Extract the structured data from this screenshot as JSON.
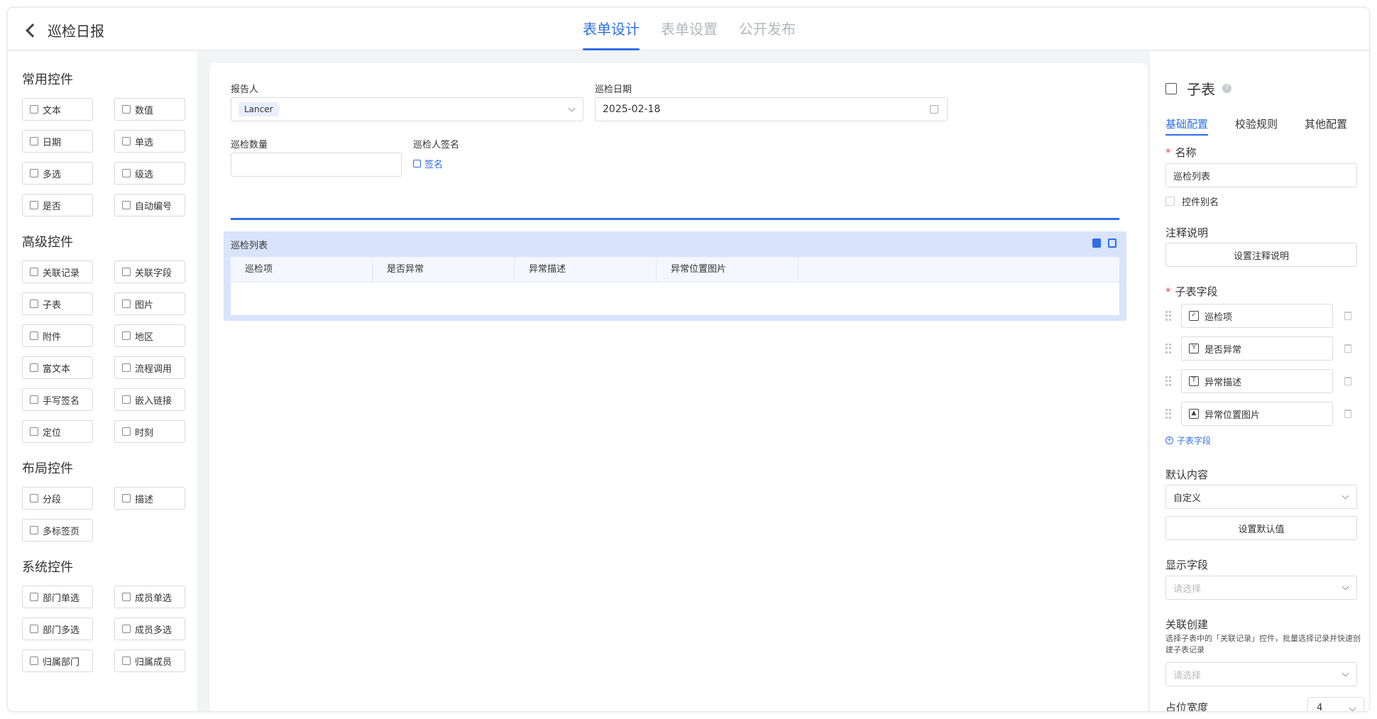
{
  "header": {
    "back_title": "巡检日报",
    "tabs": [
      {
        "label": "表单设计"
      },
      {
        "label": "表单设置"
      },
      {
        "label": "公开发布"
      }
    ]
  },
  "left_panel": {
    "groups": [
      {
        "title": "常用控件",
        "items": [
          "文本",
          "数值",
          "日期",
          "单选",
          "多选",
          "级选",
          "是否",
          "自动编号"
        ]
      },
      {
        "title": "高级控件",
        "items": [
          "关联记录",
          "关联字段",
          "子表",
          "图片",
          "附件",
          "地区",
          "富文本",
          "流程调用",
          "手写签名",
          "嵌入链接",
          "定位",
          "时刻"
        ]
      },
      {
        "title": "布局控件",
        "items": [
          "分段",
          "描述",
          "多标签页"
        ]
      },
      {
        "title": "系统控件",
        "items": [
          "部门单选",
          "成员单选",
          "部门多选",
          "成员多选",
          "归属部门",
          "归属成员"
        ]
      }
    ]
  },
  "canvas": {
    "reporter": {
      "label": "报告人",
      "value": "Lancer"
    },
    "date": {
      "label": "巡检日期",
      "value": "2025-02-18"
    },
    "count": {
      "label": "巡检数量",
      "value": ""
    },
    "signature": {
      "label": "巡检人签名",
      "link": "签名"
    },
    "subtable": {
      "title": "巡检列表",
      "columns": [
        "巡检项",
        "是否异常",
        "异常描述",
        "异常位置图片"
      ]
    }
  },
  "right_panel": {
    "title": "子表",
    "tabs": [
      "基础配置",
      "校验规则",
      "其他配置"
    ],
    "name": {
      "label": "名称",
      "value": "巡检列表"
    },
    "alias_checkbox": "控件别名",
    "comment": {
      "label": "注释说明",
      "button": "设置注释说明"
    },
    "subfields": {
      "label": "子表字段",
      "items": [
        {
          "name": "巡检项",
          "icon": "checkbox-icon"
        },
        {
          "name": "是否异常",
          "icon": "yes-no-icon"
        },
        {
          "name": "异常描述",
          "icon": "text-icon"
        },
        {
          "name": "异常位置图片",
          "icon": "image-icon"
        }
      ],
      "add_label": "子表字段"
    },
    "default_content": {
      "label": "默认内容",
      "value": "自定义",
      "button": "设置默认值"
    },
    "display_field": {
      "label": "显示字段",
      "placeholder": "请选择"
    },
    "linked_create": {
      "label": "关联创建",
      "description": "选择子表中的「关联记录」控件，批量选择记录并快速创建子表记录",
      "placeholder": "请选择"
    },
    "width": {
      "label": "占位宽度",
      "value": "4"
    }
  }
}
